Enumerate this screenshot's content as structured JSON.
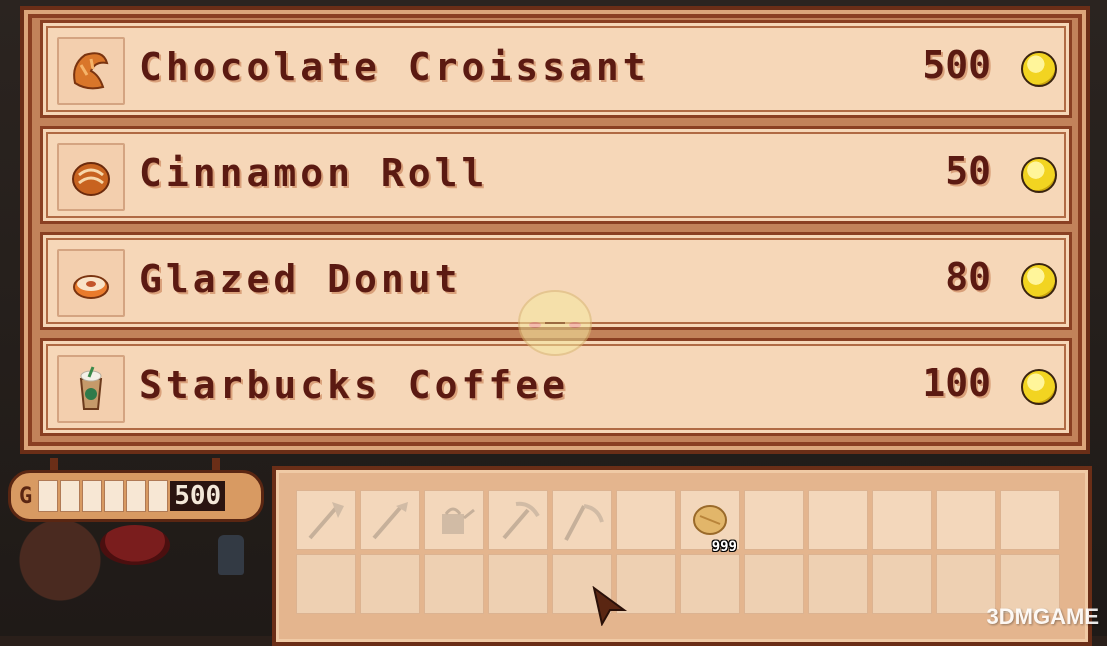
{
  "shop": {
    "items": [
      {
        "name": "Chocolate Croissant",
        "price": "500",
        "icon": "croissant-icon"
      },
      {
        "name": "Cinnamon Roll",
        "price": "50",
        "icon": "cinnamon-roll-icon"
      },
      {
        "name": "Glazed Donut",
        "price": "80",
        "icon": "donut-icon"
      },
      {
        "name": "Starbucks Coffee",
        "price": "100",
        "icon": "coffee-cup-icon"
      }
    ],
    "currency_icon": "gold-coin-icon"
  },
  "money": {
    "label": "G",
    "value": "500"
  },
  "inventory": {
    "row1": [
      {
        "icon": "axe-icon"
      },
      {
        "icon": "hoe-icon"
      },
      {
        "icon": "watering-can-icon"
      },
      {
        "icon": "pickaxe-icon"
      },
      {
        "icon": "scythe-icon"
      },
      {
        "icon": "empty"
      },
      {
        "icon": "seed-bag-icon",
        "count": "999"
      },
      {
        "icon": "empty"
      },
      {
        "icon": "empty"
      },
      {
        "icon": "empty"
      },
      {
        "icon": "empty"
      },
      {
        "icon": "empty"
      }
    ]
  },
  "watermark": "3DMGAME",
  "colors": {
    "panel_border": "#6b2e17",
    "row_bg": "#f6d7b8",
    "text": "#5b1a12",
    "coin": "#f2d421"
  }
}
